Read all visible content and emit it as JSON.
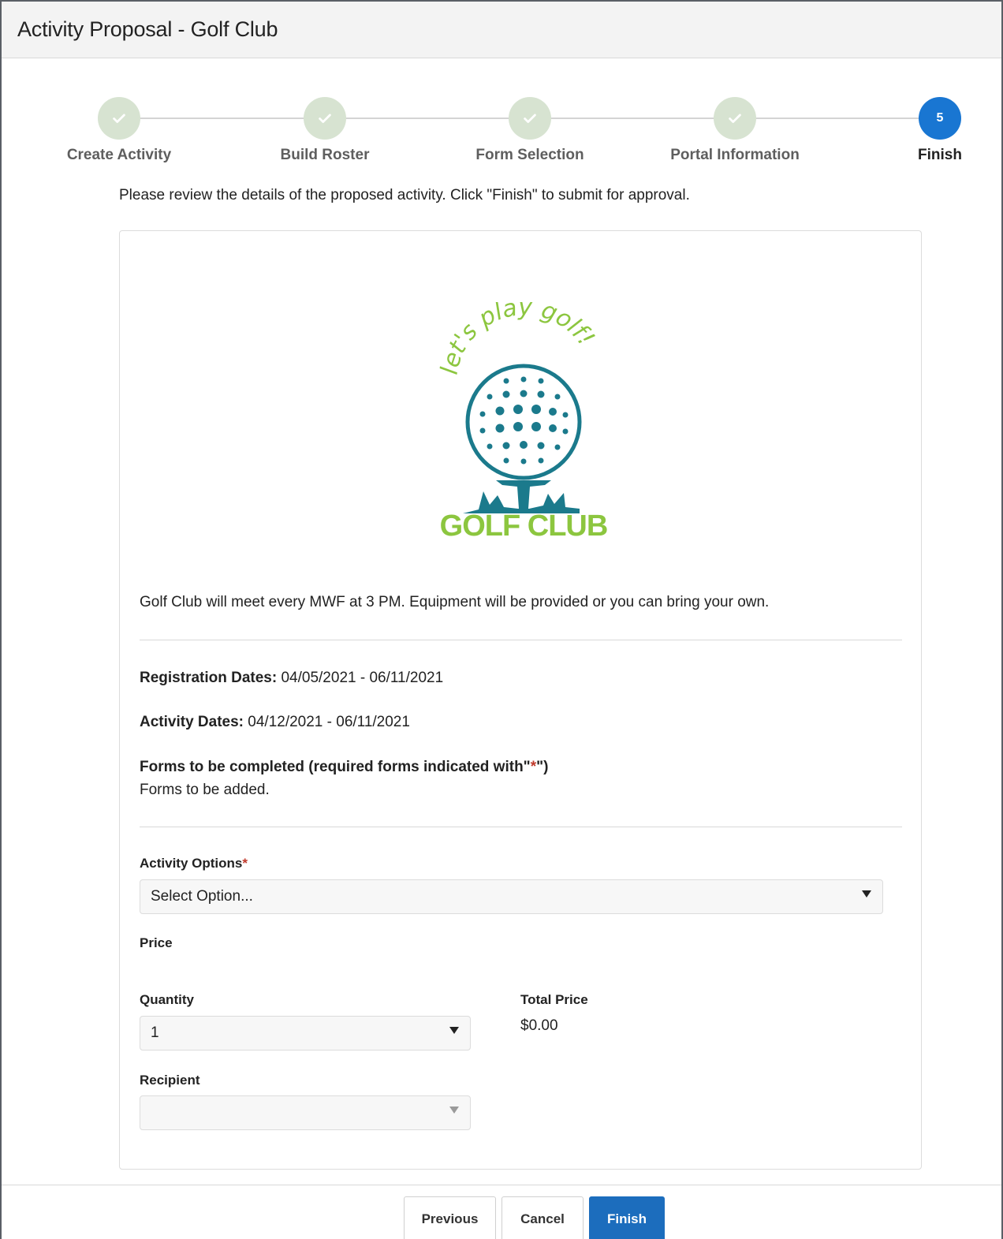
{
  "window": {
    "title": "Activity Proposal - Golf Club"
  },
  "steps": [
    {
      "label": "Create Activity",
      "state": "complete"
    },
    {
      "label": "Build Roster",
      "state": "complete"
    },
    {
      "label": "Form Selection",
      "state": "complete"
    },
    {
      "label": "Portal Information",
      "state": "complete"
    },
    {
      "label": "Finish",
      "state": "active",
      "number": "5"
    }
  ],
  "instructions": "Please review the details of the proposed activity. Click \"Finish\" to submit for approval.",
  "logo": {
    "tagline": "let's play golf!",
    "name": "GOLF CLUB"
  },
  "description": "Golf Club will meet every MWF at 3 PM. Equipment will be provided or you can bring your own.",
  "registration": {
    "label": "Registration Dates:",
    "value": "04/05/2021 - 06/11/2021"
  },
  "activity_dates": {
    "label": "Activity Dates:",
    "value": "04/12/2021 - 06/11/2021"
  },
  "forms": {
    "heading_prefix": "Forms to be completed (required forms indicated with\"",
    "heading_star": "*",
    "heading_suffix": "\")",
    "note": "Forms to be added."
  },
  "activity_options": {
    "label": "Activity Options",
    "required_mark": "*",
    "value": "Select Option..."
  },
  "price": {
    "label": "Price"
  },
  "quantity": {
    "label": "Quantity",
    "value": "1"
  },
  "total_price": {
    "label": "Total Price",
    "value": "$0.00"
  },
  "recipient": {
    "label": "Recipient",
    "value": ""
  },
  "buttons": {
    "previous": "Previous",
    "cancel": "Cancel",
    "finish": "Finish"
  },
  "colors": {
    "accent": "#1976d2",
    "complete_step": "#d7e3d1",
    "logo_teal": "#1b7a8c",
    "logo_green": "#8cc63f",
    "required": "#c0392b"
  },
  "icons": {
    "complete_step": "check-icon",
    "dropdown": "caret-down-icon"
  }
}
